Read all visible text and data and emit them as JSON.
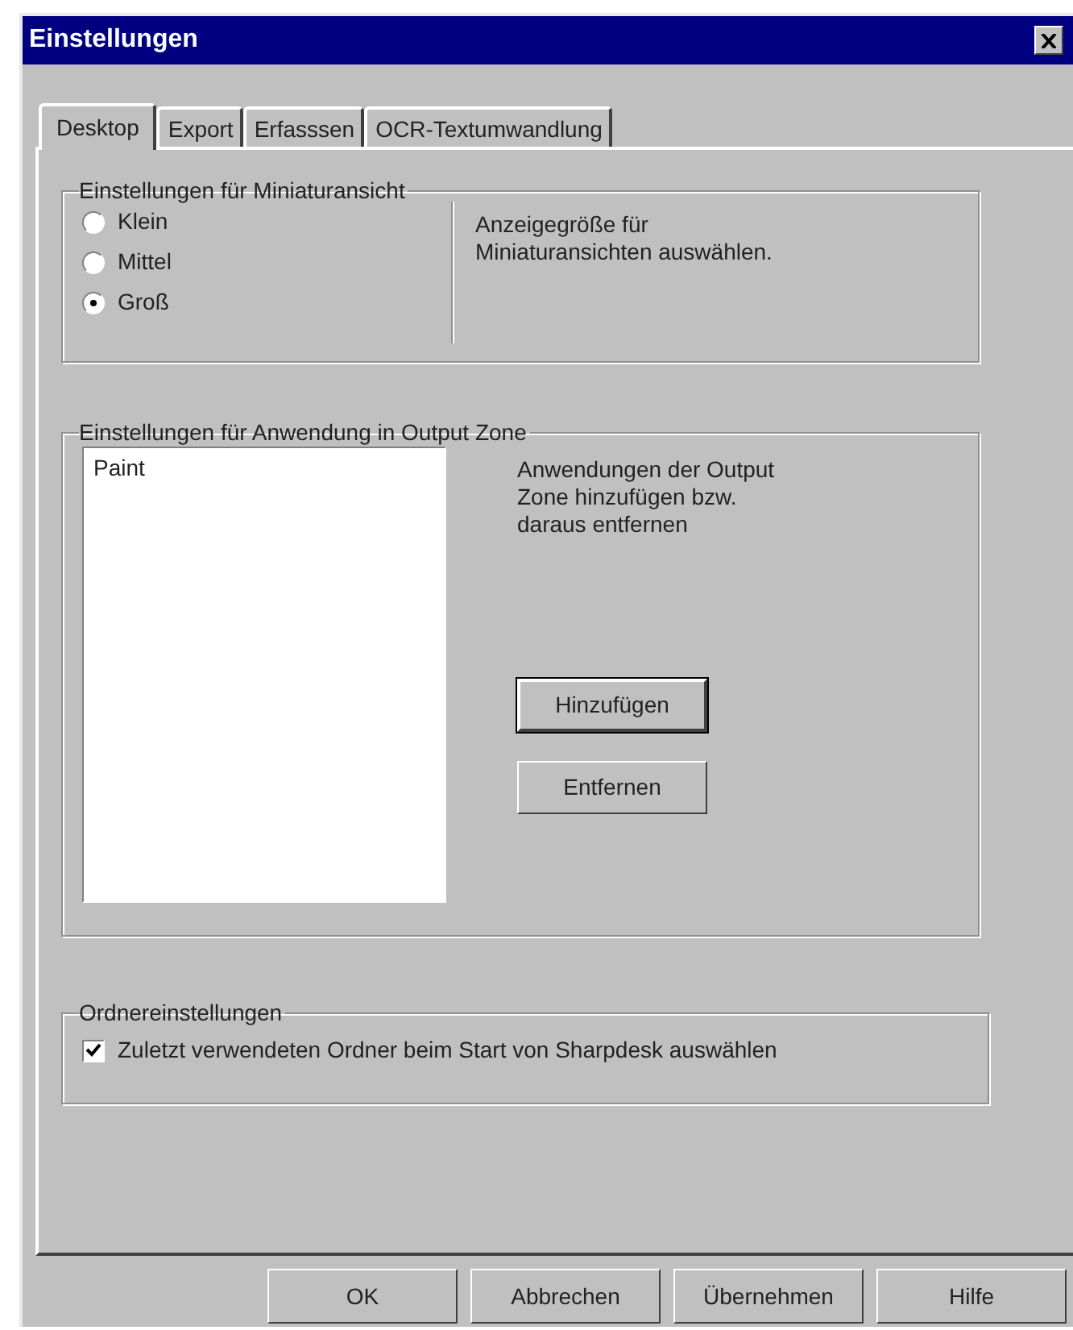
{
  "window": {
    "title": "Einstellungen"
  },
  "tabs": [
    {
      "label": "Desktop",
      "selected": true
    },
    {
      "label": "Export",
      "selected": false
    },
    {
      "label": "Erfasssen",
      "selected": false
    },
    {
      "label": "OCR-Textumwandlung",
      "selected": false
    }
  ],
  "thumbnail_group": {
    "legend": "Einstellungen für  Miniaturansicht",
    "options": [
      {
        "label": "Klein",
        "selected": false
      },
      {
        "label": "Mittel",
        "selected": false
      },
      {
        "label": "Groß",
        "selected": true
      }
    ],
    "description": "Anzeigegröße für\nMiniaturansichten auswählen."
  },
  "output_zone_group": {
    "legend": "Einstellungen für  Anwendung in Output Zone",
    "applications": [
      {
        "label": "Paint"
      }
    ],
    "description": "Anwendungen der Output\nZone hinzufügen bzw.\ndaraus entfernen",
    "buttons": [
      {
        "label": "Hinzufügen",
        "default": true
      },
      {
        "label": "Entfernen",
        "default": false
      }
    ]
  },
  "folder_group": {
    "legend": "Ordnereinstellungen",
    "checkbox": {
      "label": "Zuletzt verwendeten Ordner beim Start von Sharpdesk auswählen",
      "checked": true
    }
  },
  "buttons": [
    {
      "label": "OK"
    },
    {
      "label": "Abbrechen"
    },
    {
      "label": "Übernehmen"
    },
    {
      "label": "Hilfe"
    }
  ]
}
